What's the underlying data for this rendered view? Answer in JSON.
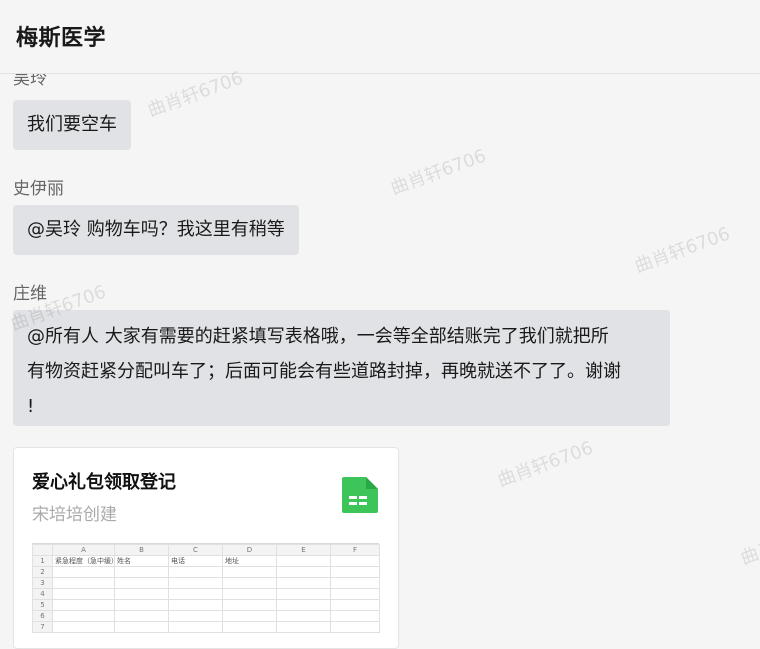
{
  "header": {
    "title": "梅斯医学"
  },
  "messages": [
    {
      "sender": "吴玲",
      "text": "我们要空车"
    },
    {
      "sender": "史伊丽",
      "text": "@吴玲  购物车吗？我这里有稍等"
    },
    {
      "sender": "庄维",
      "text_line1": "@所有人  大家有需要的赶紧填写表格哦，一会等全部结账完了我们就把所",
      "text_line2": "有物资赶紧分配叫车了；后面可能会有些道路封掉，再晚就送不了了。谢谢",
      "text_line3": "!"
    }
  ],
  "card": {
    "title": "爱心礼包领取登记",
    "subtitle": "宋培培创建",
    "icon": "spreadsheet-icon",
    "accent": "#3ec55a",
    "sheet": {
      "columns": [
        "A",
        "B",
        "C",
        "D",
        "E",
        "F"
      ],
      "rows": [
        [
          "1",
          "紧急程度（急中缓）",
          "姓名",
          "电话",
          "地址",
          "",
          ""
        ],
        [
          "2",
          "",
          "",
          "",
          "",
          "",
          ""
        ],
        [
          "3",
          "",
          "",
          "",
          "",
          "",
          ""
        ],
        [
          "4",
          "",
          "",
          "",
          "",
          "",
          ""
        ],
        [
          "5",
          "",
          "",
          "",
          "",
          "",
          ""
        ],
        [
          "6",
          "",
          "",
          "",
          "",
          "",
          ""
        ],
        [
          "7",
          "",
          "",
          "",
          "",
          "",
          ""
        ]
      ]
    }
  },
  "watermark": "曲肖轩6706"
}
